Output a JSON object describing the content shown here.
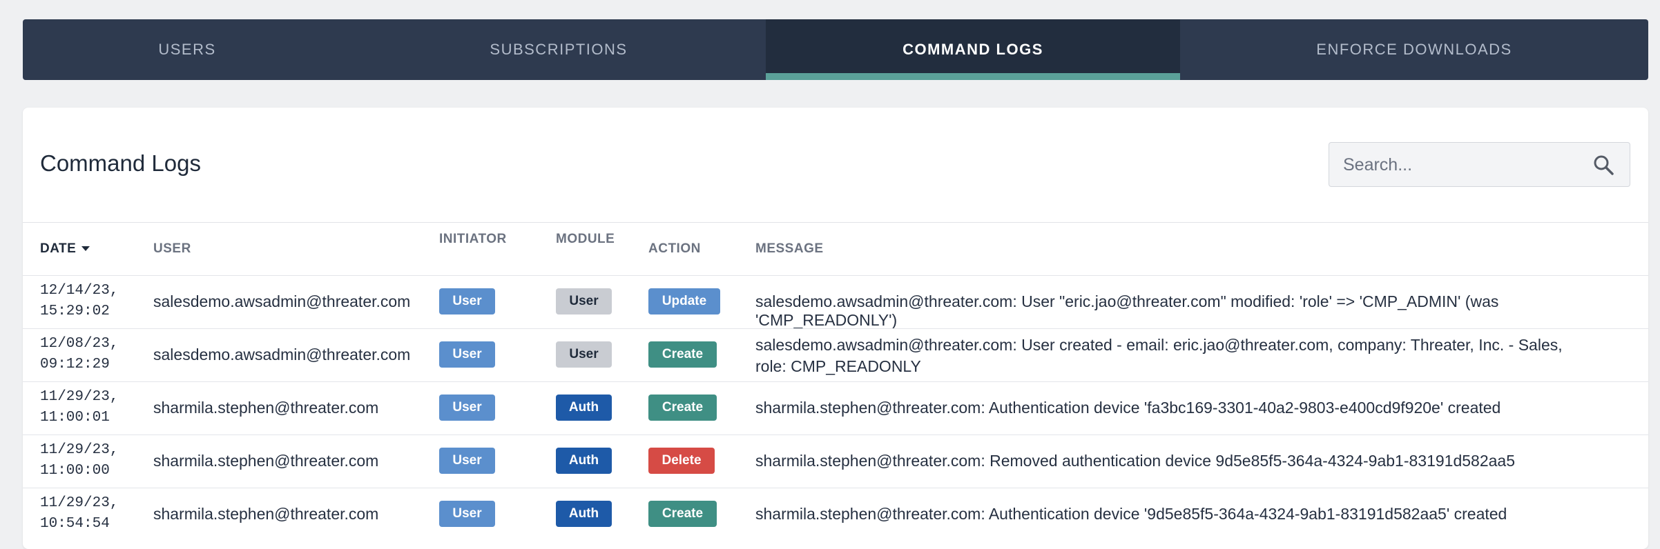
{
  "tabs": [
    {
      "label": "USERS"
    },
    {
      "label": "SUBSCRIPTIONS"
    },
    {
      "label": "COMMAND LOGS",
      "active": true
    },
    {
      "label": "ENFORCE DOWNLOADS"
    }
  ],
  "page": {
    "title": "Command Logs",
    "search_placeholder": "Search..."
  },
  "table": {
    "columns": [
      "DATE",
      "USER",
      "INITIATOR",
      "MODULE",
      "ACTION",
      "MESSAGE"
    ],
    "rows": [
      {
        "date": "12/14/23,\n15:29:02",
        "user": "salesdemo.awsadmin@threater.com",
        "initiator": "User",
        "module": "User",
        "action": "Update",
        "message": "salesdemo.awsadmin@threater.com: User \"eric.jao@threater.com\" modified: 'role' => 'CMP_ADMIN' (was 'CMP_READONLY')"
      },
      {
        "date": "12/08/23,\n09:12:29",
        "user": "salesdemo.awsadmin@threater.com",
        "initiator": "User",
        "module": "User",
        "action": "Create",
        "message": "salesdemo.awsadmin@threater.com: User created - email: eric.jao@threater.com, company: Threater, Inc. - Sales, role: CMP_READONLY"
      },
      {
        "date": "11/29/23,\n11:00:01",
        "user": "sharmila.stephen@threater.com",
        "initiator": "User",
        "module": "Auth",
        "action": "Create",
        "message": "sharmila.stephen@threater.com: Authentication device 'fa3bc169-3301-40a2-9803-e400cd9f920e' created"
      },
      {
        "date": "11/29/23,\n11:00:00",
        "user": "sharmila.stephen@threater.com",
        "initiator": "User",
        "module": "Auth",
        "action": "Delete",
        "message": "sharmila.stephen@threater.com: Removed authentication device 9d5e85f5-364a-4324-9ab1-83191d582aa5"
      },
      {
        "date": "11/29/23,\n10:54:54",
        "user": "sharmila.stephen@threater.com",
        "initiator": "User",
        "module": "Auth",
        "action": "Create",
        "message": "sharmila.stephen@threater.com: Authentication device '9d5e85f5-364a-4324-9ab1-83191d582aa5' created"
      }
    ]
  },
  "colors": {
    "tab_bar": "#2e3a4f",
    "tab_active": "#222d3e",
    "tab_indicator": "#5ba199",
    "badge_user": "#5b8fcd",
    "badge_module_user": "#c9ccd2",
    "badge_auth": "#1e5aa8",
    "badge_create": "#3f8f84",
    "badge_delete": "#d64b45"
  },
  "icons": {
    "search": "search-icon",
    "sort": "caret-down-icon"
  }
}
